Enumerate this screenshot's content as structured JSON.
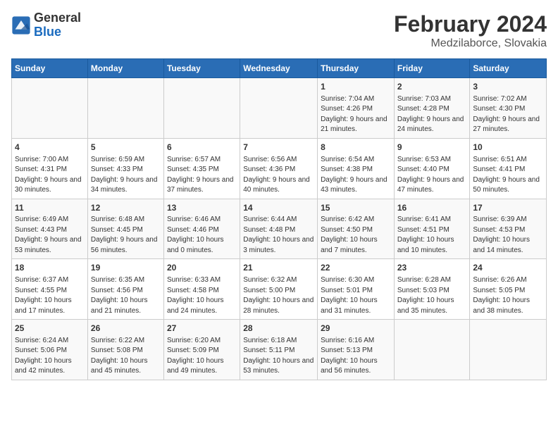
{
  "logo": {
    "general": "General",
    "blue": "Blue"
  },
  "title": "February 2024",
  "subtitle": "Medzilaborce, Slovakia",
  "days_of_week": [
    "Sunday",
    "Monday",
    "Tuesday",
    "Wednesday",
    "Thursday",
    "Friday",
    "Saturday"
  ],
  "weeks": [
    [
      {
        "day": "",
        "info": ""
      },
      {
        "day": "",
        "info": ""
      },
      {
        "day": "",
        "info": ""
      },
      {
        "day": "",
        "info": ""
      },
      {
        "day": "1",
        "info": "Sunrise: 7:04 AM\nSunset: 4:26 PM\nDaylight: 9 hours and 21 minutes."
      },
      {
        "day": "2",
        "info": "Sunrise: 7:03 AM\nSunset: 4:28 PM\nDaylight: 9 hours and 24 minutes."
      },
      {
        "day": "3",
        "info": "Sunrise: 7:02 AM\nSunset: 4:30 PM\nDaylight: 9 hours and 27 minutes."
      }
    ],
    [
      {
        "day": "4",
        "info": "Sunrise: 7:00 AM\nSunset: 4:31 PM\nDaylight: 9 hours and 30 minutes."
      },
      {
        "day": "5",
        "info": "Sunrise: 6:59 AM\nSunset: 4:33 PM\nDaylight: 9 hours and 34 minutes."
      },
      {
        "day": "6",
        "info": "Sunrise: 6:57 AM\nSunset: 4:35 PM\nDaylight: 9 hours and 37 minutes."
      },
      {
        "day": "7",
        "info": "Sunrise: 6:56 AM\nSunset: 4:36 PM\nDaylight: 9 hours and 40 minutes."
      },
      {
        "day": "8",
        "info": "Sunrise: 6:54 AM\nSunset: 4:38 PM\nDaylight: 9 hours and 43 minutes."
      },
      {
        "day": "9",
        "info": "Sunrise: 6:53 AM\nSunset: 4:40 PM\nDaylight: 9 hours and 47 minutes."
      },
      {
        "day": "10",
        "info": "Sunrise: 6:51 AM\nSunset: 4:41 PM\nDaylight: 9 hours and 50 minutes."
      }
    ],
    [
      {
        "day": "11",
        "info": "Sunrise: 6:49 AM\nSunset: 4:43 PM\nDaylight: 9 hours and 53 minutes."
      },
      {
        "day": "12",
        "info": "Sunrise: 6:48 AM\nSunset: 4:45 PM\nDaylight: 9 hours and 56 minutes."
      },
      {
        "day": "13",
        "info": "Sunrise: 6:46 AM\nSunset: 4:46 PM\nDaylight: 10 hours and 0 minutes."
      },
      {
        "day": "14",
        "info": "Sunrise: 6:44 AM\nSunset: 4:48 PM\nDaylight: 10 hours and 3 minutes."
      },
      {
        "day": "15",
        "info": "Sunrise: 6:42 AM\nSunset: 4:50 PM\nDaylight: 10 hours and 7 minutes."
      },
      {
        "day": "16",
        "info": "Sunrise: 6:41 AM\nSunset: 4:51 PM\nDaylight: 10 hours and 10 minutes."
      },
      {
        "day": "17",
        "info": "Sunrise: 6:39 AM\nSunset: 4:53 PM\nDaylight: 10 hours and 14 minutes."
      }
    ],
    [
      {
        "day": "18",
        "info": "Sunrise: 6:37 AM\nSunset: 4:55 PM\nDaylight: 10 hours and 17 minutes."
      },
      {
        "day": "19",
        "info": "Sunrise: 6:35 AM\nSunset: 4:56 PM\nDaylight: 10 hours and 21 minutes."
      },
      {
        "day": "20",
        "info": "Sunrise: 6:33 AM\nSunset: 4:58 PM\nDaylight: 10 hours and 24 minutes."
      },
      {
        "day": "21",
        "info": "Sunrise: 6:32 AM\nSunset: 5:00 PM\nDaylight: 10 hours and 28 minutes."
      },
      {
        "day": "22",
        "info": "Sunrise: 6:30 AM\nSunset: 5:01 PM\nDaylight: 10 hours and 31 minutes."
      },
      {
        "day": "23",
        "info": "Sunrise: 6:28 AM\nSunset: 5:03 PM\nDaylight: 10 hours and 35 minutes."
      },
      {
        "day": "24",
        "info": "Sunrise: 6:26 AM\nSunset: 5:05 PM\nDaylight: 10 hours and 38 minutes."
      }
    ],
    [
      {
        "day": "25",
        "info": "Sunrise: 6:24 AM\nSunset: 5:06 PM\nDaylight: 10 hours and 42 minutes."
      },
      {
        "day": "26",
        "info": "Sunrise: 6:22 AM\nSunset: 5:08 PM\nDaylight: 10 hours and 45 minutes."
      },
      {
        "day": "27",
        "info": "Sunrise: 6:20 AM\nSunset: 5:09 PM\nDaylight: 10 hours and 49 minutes."
      },
      {
        "day": "28",
        "info": "Sunrise: 6:18 AM\nSunset: 5:11 PM\nDaylight: 10 hours and 53 minutes."
      },
      {
        "day": "29",
        "info": "Sunrise: 6:16 AM\nSunset: 5:13 PM\nDaylight: 10 hours and 56 minutes."
      },
      {
        "day": "",
        "info": ""
      },
      {
        "day": "",
        "info": ""
      }
    ]
  ]
}
